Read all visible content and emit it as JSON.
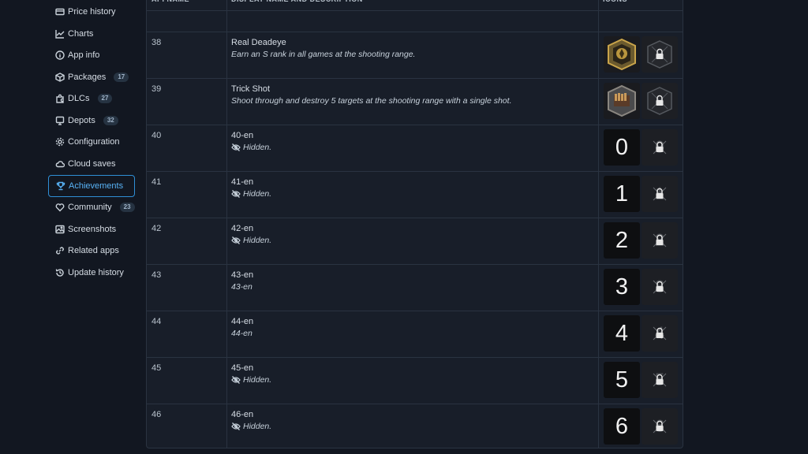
{
  "sidebar": {
    "items": [
      {
        "label": "Price history",
        "icon": "price-history-icon"
      },
      {
        "label": "Charts",
        "icon": "charts-icon"
      },
      {
        "label": "App info",
        "icon": "info-icon"
      },
      {
        "label": "Packages",
        "icon": "package-icon",
        "badge": "17"
      },
      {
        "label": "DLCs",
        "icon": "dlc-icon",
        "badge": "27"
      },
      {
        "label": "Depots",
        "icon": "depot-icon",
        "badge": "32"
      },
      {
        "label": "Configuration",
        "icon": "gear-icon"
      },
      {
        "label": "Cloud saves",
        "icon": "cloud-icon"
      },
      {
        "label": "Achievements",
        "icon": "trophy-icon",
        "active": true
      },
      {
        "label": "Community",
        "icon": "heart-icon",
        "badge": "23"
      },
      {
        "label": "Screenshots",
        "icon": "image-icon"
      },
      {
        "label": "Related apps",
        "icon": "link-icon"
      },
      {
        "label": "Update history",
        "icon": "history-icon"
      }
    ]
  },
  "table": {
    "headers": {
      "api": "API NAME",
      "display": "DISPLAY NAME AND DESCRIPTION",
      "icons": "ICONS"
    },
    "rows": [
      {
        "api": "38",
        "name": "Real Deadeye",
        "desc": "Earn an S rank in all games at the shooting range.",
        "hidden": false,
        "icon": "gold-emblem-icon"
      },
      {
        "api": "39",
        "name": "Trick Shot",
        "desc": "Shoot through and destroy 5 targets at the shooting range with a single shot.",
        "hidden": false,
        "icon": "bullets-emblem-icon"
      },
      {
        "api": "40",
        "name": "40-en",
        "desc": "Hidden.",
        "hidden": true,
        "digit": "0"
      },
      {
        "api": "41",
        "name": "41-en",
        "desc": "Hidden.",
        "hidden": true,
        "digit": "1"
      },
      {
        "api": "42",
        "name": "42-en",
        "desc": "Hidden.",
        "hidden": true,
        "digit": "2"
      },
      {
        "api": "43",
        "name": "43-en",
        "desc": "43-en",
        "hidden": false,
        "digit": "3"
      },
      {
        "api": "44",
        "name": "44-en",
        "desc": "44-en",
        "hidden": false,
        "digit": "4"
      },
      {
        "api": "45",
        "name": "45-en",
        "desc": "Hidden.",
        "hidden": true,
        "digit": "5"
      },
      {
        "api": "46",
        "name": "46-en",
        "desc": "Hidden.",
        "hidden": true,
        "digit": "6"
      }
    ]
  },
  "colors": {
    "accent": "#58b2f5",
    "background": "#121721",
    "table_bg": "#181e29",
    "border": "#2a3341"
  }
}
